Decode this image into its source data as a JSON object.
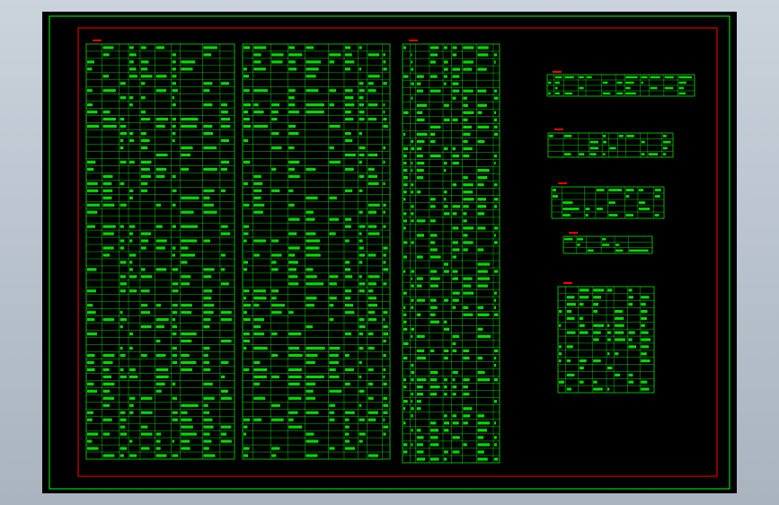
{
  "drawing": {
    "background_color": "#000000",
    "outer_frame_color": "#00ff00",
    "inner_frame_color": "#ff0000",
    "table_line_color": "#00ff00",
    "title_text_color": "#ff0000",
    "text_color": "#00ff00"
  },
  "tables": [
    {
      "id": "list-1",
      "title": "",
      "rows": 58,
      "cols": 10
    },
    {
      "id": "list-2",
      "title": "",
      "rows": 58,
      "cols": 10
    },
    {
      "id": "list-3",
      "title": "",
      "rows": 58,
      "cols": 9
    },
    {
      "id": "table-a",
      "title": "",
      "rows": 4,
      "cols": 12
    },
    {
      "id": "table-b",
      "title": "",
      "rows": 4,
      "cols": 11
    },
    {
      "id": "table-c",
      "title": "",
      "rows": 5,
      "cols": 8
    },
    {
      "id": "table-d",
      "title": "",
      "rows": 3,
      "cols": 6
    },
    {
      "id": "table-e",
      "title": "",
      "rows": 15,
      "cols": 8
    }
  ]
}
